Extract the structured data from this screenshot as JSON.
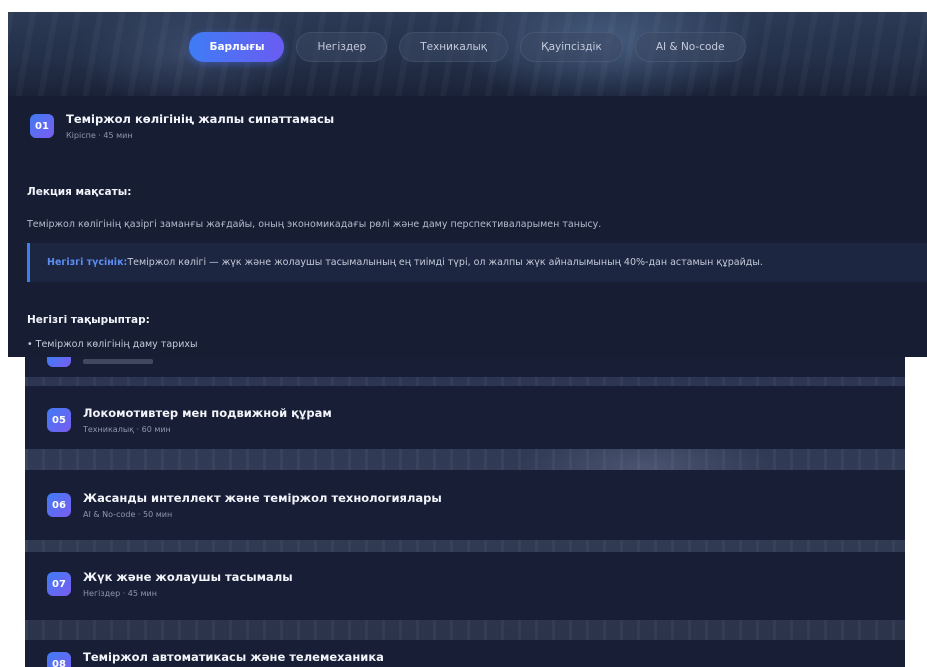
{
  "filters": [
    {
      "label": "Барлығы",
      "active": true
    },
    {
      "label": "Негіздер",
      "active": false
    },
    {
      "label": "Техникалық",
      "active": false
    },
    {
      "label": "Қауіпсіздік",
      "active": false
    },
    {
      "label": "AI & No-code",
      "active": false
    }
  ],
  "open_lesson": {
    "number": "01",
    "title": "Теміржол көлігінің жалпы сипаттамасы",
    "meta": "Кіріспе · 45 мин",
    "goal_heading": "Лекция мақсаты:",
    "goal_text": "Теміржол көлігінің қазіргі заманғы жағдайы, оның экономикадағы рөлі және даму перспективаларымен танысу.",
    "key_label": "Негізгі түсінік:",
    "key_text": " Теміржол көлігі — жүк және жолаушы тасымалының ең тиімді түрі, ол жалпы жүк айналымының 40%-дан астамын құрайды.",
    "topics_heading": "Негізгі тақырыптар:",
    "topics": [
      "Теміржол көлігінің даму тарихы"
    ]
  },
  "lessons": [
    {
      "number": "05",
      "title": "Локомотивтер мен подвижной құрам",
      "meta": "Техникалық · 60 мин"
    },
    {
      "number": "06",
      "title": "Жасанды интеллект және теміржол технологиялары",
      "meta": "AI & No-code · 50 мин"
    },
    {
      "number": "07",
      "title": "Жүк және жолаушы тасымалы",
      "meta": "Негіздер · 45 мин"
    },
    {
      "number": "08",
      "title": "Теміржол автоматикасы және телемеханика",
      "meta": ""
    }
  ],
  "colors": {
    "accent_blue": "#3f7cf4",
    "accent_purple": "#7b5cf0",
    "panel": "#171e34",
    "key_border": "#3d7ef0"
  }
}
